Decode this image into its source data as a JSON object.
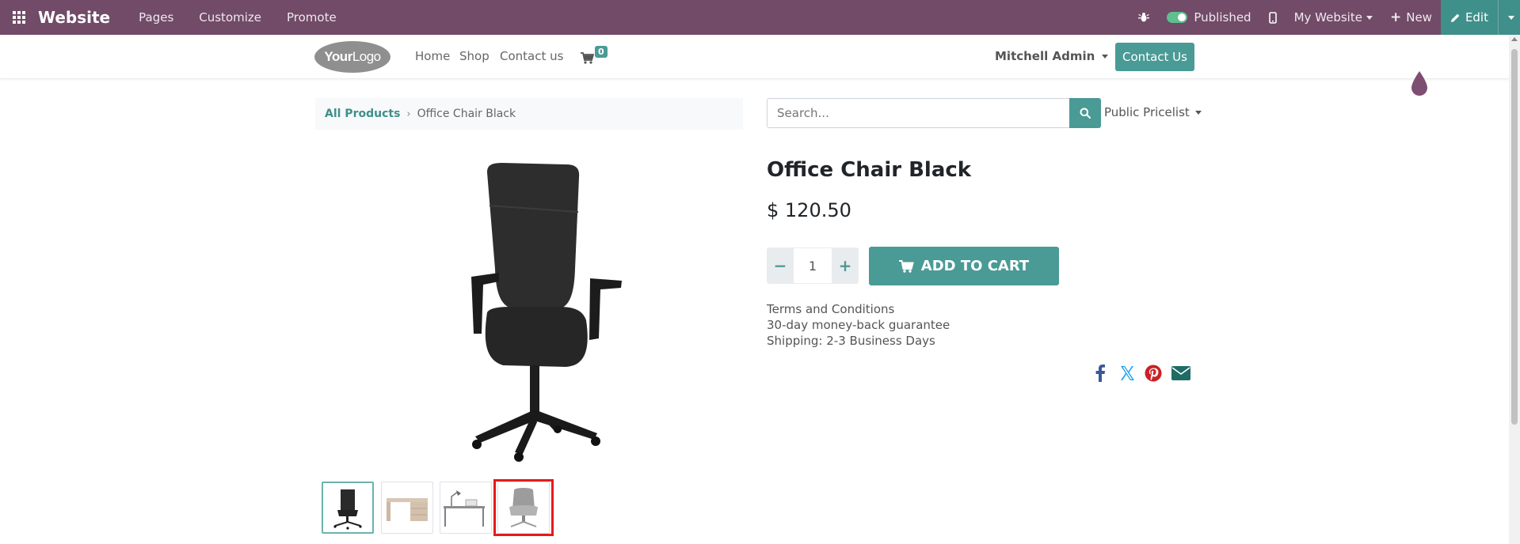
{
  "admin_bar": {
    "app_name": "Website",
    "menu": [
      "Pages",
      "Customize",
      "Promote"
    ],
    "published_label": "Published",
    "site_label": "My Website",
    "new_label": "New",
    "edit_label": "Edit"
  },
  "header": {
    "logo_bold": "Your",
    "logo_light": "Logo",
    "nav": [
      "Home",
      "Shop",
      "Contact us"
    ],
    "cart_count": "0",
    "user_name": "Mitchell Admin",
    "contact_button": "Contact Us"
  },
  "breadcrumb": {
    "parent": "All Products",
    "current": "Office Chair Black"
  },
  "search": {
    "placeholder": "Search...",
    "pricelist": "Public Pricelist"
  },
  "product": {
    "name": "Office Chair Black",
    "price": "$ 120.50",
    "quantity": "1",
    "add_to_cart": "ADD TO CART",
    "terms": [
      "Terms and Conditions",
      "30-day money-back guarantee",
      "Shipping: 2-3 Business Days"
    ]
  },
  "colors": {
    "admin_bar": "#714B67",
    "primary": "#4a9a96",
    "highlight": "#e31b1b"
  },
  "share_icons": [
    "facebook-icon",
    "x-twitter-icon",
    "pinterest-icon",
    "email-icon"
  ],
  "thumbnails": [
    "office-chair-black",
    "wooden-desk",
    "desk-with-lamp",
    "grey-lounge-chair"
  ]
}
